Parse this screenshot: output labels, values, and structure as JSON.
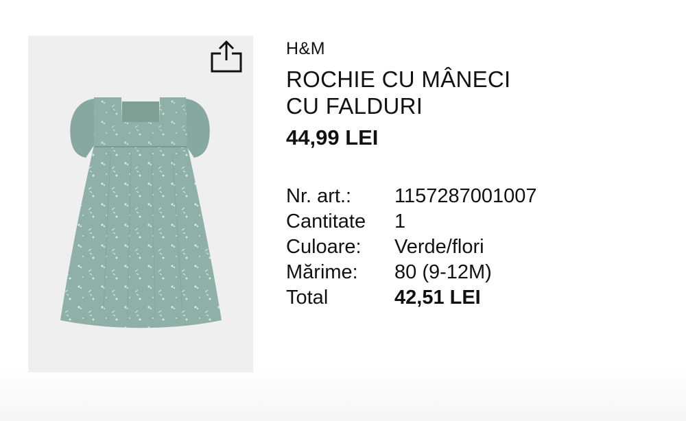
{
  "product": {
    "brand": "H&M",
    "title_line1": "ROCHIE CU MÂNECI",
    "title_line2": "CU FALDURI",
    "price": "44,99 LEI",
    "image_icon": "dress-image",
    "image_color": "#8fb0a6"
  },
  "actions": {
    "share_icon": "share-icon"
  },
  "details": [
    {
      "label": "Nr. art.:",
      "value": "1157287001007"
    },
    {
      "label": "Cantitate",
      "value": "1"
    },
    {
      "label": "Culoare:",
      "value": "Verde/flori"
    },
    {
      "label": "Mărime:",
      "value": "80 (9-12M)"
    },
    {
      "label": "Total",
      "value": "42,51 LEI"
    }
  ]
}
